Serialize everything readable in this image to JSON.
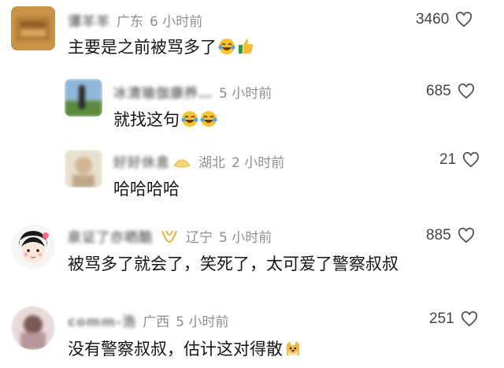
{
  "comments": [
    {
      "name": "谭羊羊",
      "location": "广东",
      "time": "6 小时前",
      "text": "主要是之前被骂多了",
      "likes": "3460",
      "emoji": [
        "laugh-cry-emoji",
        "thumbs-up-emoji"
      ]
    },
    {
      "name": "冰清瑜伽康养…",
      "location": "",
      "time": "5 小时前",
      "text": "就找这句",
      "likes": "685",
      "emoji": [
        "laugh-cry-emoji",
        "laugh-cry-emoji"
      ]
    },
    {
      "name": "好好休息",
      "location": "湖北",
      "time": "2 小时前",
      "text": "哈哈哈哈",
      "likes": "21",
      "emoji": []
    },
    {
      "name": "泉证了亦晒酷",
      "location": "辽宁",
      "time": "5 小时前",
      "text": "被骂多了就会了，笑死了，太可爱了警察叔叔",
      "likes": "885",
      "emoji": []
    },
    {
      "name": "comm-浩",
      "location": "广西",
      "time": "5 小时前",
      "text": "没有警察叔叔，估计这对得散",
      "likes": "251",
      "emoji": [
        "doge-emoji"
      ]
    }
  ],
  "icons": {
    "like": "heart-outline-icon"
  },
  "colors": {
    "text": "#161616",
    "meta": "#8f8f8f",
    "background": "#ffffff"
  }
}
